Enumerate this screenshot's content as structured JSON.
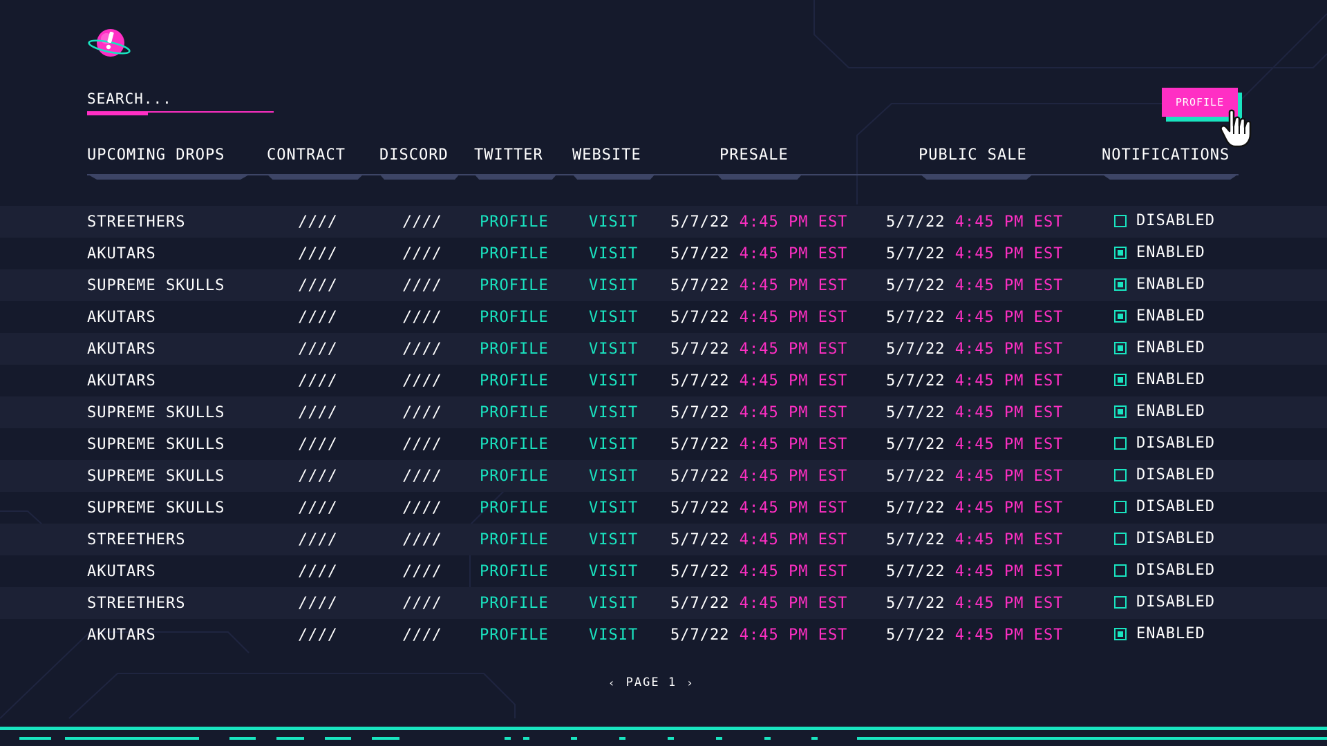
{
  "search": {
    "placeholder": "SEARCH..."
  },
  "profile_button": {
    "label": "PROFILE"
  },
  "colors": {
    "accent_pink": "#ff2fc4",
    "accent_teal": "#19e4c0",
    "background": "#151a2c"
  },
  "icons": {
    "logo": "planet-exclamation-logo",
    "cursor": "hand-pointer-icon"
  },
  "table": {
    "headers": {
      "name": "UPCOMING DROPS",
      "contract": "CONTRACT",
      "discord": "DISCORD",
      "twitter": "TWITTER",
      "website": "WEBSITE",
      "presale": "PRESALE",
      "public_sale": "PUBLIC SALE",
      "notifications": "NOTIFICATIONS"
    },
    "rows": [
      {
        "name": "STREETHERS",
        "contract": "////",
        "discord": "////",
        "twitter": "PROFILE",
        "website": "VISIT",
        "presale_date": "5/7/22",
        "presale_time": "4:45 PM EST",
        "public_date": "5/7/22",
        "public_time": "4:45 PM EST",
        "notif": "DISABLED",
        "enabled": false
      },
      {
        "name": "AKUTARS",
        "contract": "////",
        "discord": "////",
        "twitter": "PROFILE",
        "website": "VISIT",
        "presale_date": "5/7/22",
        "presale_time": "4:45 PM EST",
        "public_date": "5/7/22",
        "public_time": "4:45 PM EST",
        "notif": "ENABLED",
        "enabled": true
      },
      {
        "name": "SUPREME SKULLS",
        "contract": "////",
        "discord": "////",
        "twitter": "PROFILE",
        "website": "VISIT",
        "presale_date": "5/7/22",
        "presale_time": "4:45 PM EST",
        "public_date": "5/7/22",
        "public_time": "4:45 PM EST",
        "notif": "ENABLED",
        "enabled": true
      },
      {
        "name": "AKUTARS",
        "contract": "////",
        "discord": "////",
        "twitter": "PROFILE",
        "website": "VISIT",
        "presale_date": "5/7/22",
        "presale_time": "4:45 PM EST",
        "public_date": "5/7/22",
        "public_time": "4:45 PM EST",
        "notif": "ENABLED",
        "enabled": true
      },
      {
        "name": "AKUTARS",
        "contract": "////",
        "discord": "////",
        "twitter": "PROFILE",
        "website": "VISIT",
        "presale_date": "5/7/22",
        "presale_time": "4:45 PM EST",
        "public_date": "5/7/22",
        "public_time": "4:45 PM EST",
        "notif": "ENABLED",
        "enabled": true
      },
      {
        "name": "AKUTARS",
        "contract": "////",
        "discord": "////",
        "twitter": "PROFILE",
        "website": "VISIT",
        "presale_date": "5/7/22",
        "presale_time": "4:45 PM EST",
        "public_date": "5/7/22",
        "public_time": "4:45 PM EST",
        "notif": "ENABLED",
        "enabled": true
      },
      {
        "name": "SUPREME SKULLS",
        "contract": "////",
        "discord": "////",
        "twitter": "PROFILE",
        "website": "VISIT",
        "presale_date": "5/7/22",
        "presale_time": "4:45 PM EST",
        "public_date": "5/7/22",
        "public_time": "4:45 PM EST",
        "notif": "ENABLED",
        "enabled": true
      },
      {
        "name": "SUPREME SKULLS",
        "contract": "////",
        "discord": "////",
        "twitter": "PROFILE",
        "website": "VISIT",
        "presale_date": "5/7/22",
        "presale_time": "4:45 PM EST",
        "public_date": "5/7/22",
        "public_time": "4:45 PM EST",
        "notif": "DISABLED",
        "enabled": false
      },
      {
        "name": "SUPREME SKULLS",
        "contract": "////",
        "discord": "////",
        "twitter": "PROFILE",
        "website": "VISIT",
        "presale_date": "5/7/22",
        "presale_time": "4:45 PM EST",
        "public_date": "5/7/22",
        "public_time": "4:45 PM EST",
        "notif": "DISABLED",
        "enabled": false
      },
      {
        "name": "SUPREME SKULLS",
        "contract": "////",
        "discord": "////",
        "twitter": "PROFILE",
        "website": "VISIT",
        "presale_date": "5/7/22",
        "presale_time": "4:45 PM EST",
        "public_date": "5/7/22",
        "public_time": "4:45 PM EST",
        "notif": "DISABLED",
        "enabled": false
      },
      {
        "name": "STREETHERS",
        "contract": "////",
        "discord": "////",
        "twitter": "PROFILE",
        "website": "VISIT",
        "presale_date": "5/7/22",
        "presale_time": "4:45 PM EST",
        "public_date": "5/7/22",
        "public_time": "4:45 PM EST",
        "notif": "DISABLED",
        "enabled": false
      },
      {
        "name": "AKUTARS",
        "contract": "////",
        "discord": "////",
        "twitter": "PROFILE",
        "website": "VISIT",
        "presale_date": "5/7/22",
        "presale_time": "4:45 PM EST",
        "public_date": "5/7/22",
        "public_time": "4:45 PM EST",
        "notif": "DISABLED",
        "enabled": false
      },
      {
        "name": "STREETHERS",
        "contract": "////",
        "discord": "////",
        "twitter": "PROFILE",
        "website": "VISIT",
        "presale_date": "5/7/22",
        "presale_time": "4:45 PM EST",
        "public_date": "5/7/22",
        "public_time": "4:45 PM EST",
        "notif": "DISABLED",
        "enabled": false
      },
      {
        "name": "AKUTARS",
        "contract": "////",
        "discord": "////",
        "twitter": "PROFILE",
        "website": "VISIT",
        "presale_date": "5/7/22",
        "presale_time": "4:45 PM EST",
        "public_date": "5/7/22",
        "public_time": "4:45 PM EST",
        "notif": "ENABLED",
        "enabled": true
      }
    ]
  },
  "pagination": {
    "prev": "‹",
    "label": "PAGE 1",
    "next": "›"
  }
}
